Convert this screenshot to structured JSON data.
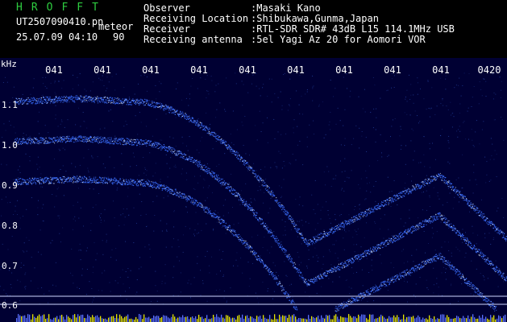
{
  "header": {
    "logo": "HROFFT",
    "filename": "UT2507090410.pn",
    "tag": "meteor",
    "datetime": "25.07.09 04:10",
    "angle": "90",
    "info": [
      {
        "key": "Observer",
        "value": ":Masaki Kano"
      },
      {
        "key": "Receiving Location",
        "value": ":Shibukawa,Gunma,Japan"
      },
      {
        "key": "Receiver",
        "value": ":RTL-SDR SDR# 43dB L15 114.1MHz USB"
      },
      {
        "key": "Receiving antenna",
        "value": ":5el Yagi Az 20 for Aomori VOR"
      }
    ]
  },
  "plot": {
    "y_unit": "kHz",
    "y_ticks": [
      "1.1",
      "1.0",
      "0.9",
      "0.8",
      "0.7",
      "0.6"
    ],
    "x_ticks": [
      "041",
      "041",
      "041",
      "041",
      "041",
      "041",
      "041",
      "041",
      "041",
      "0420"
    ],
    "colors": {
      "background": "#000033",
      "signal": "#3a6fff",
      "bright": "#cfe3ff",
      "noise": "#e6e600"
    }
  }
}
